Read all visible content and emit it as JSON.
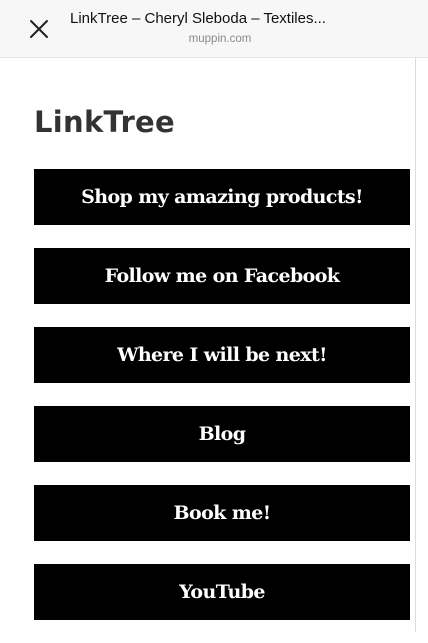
{
  "browser": {
    "title": "LinkTree – Cheryl Sleboda – Textiles...",
    "domain": "muppin.com"
  },
  "page": {
    "heading": "LinkTree"
  },
  "links": [
    "Shop my amazing products!",
    "Follow me on Facebook",
    "Where I will be next!",
    "Blog",
    "Book me!",
    "YouTube"
  ]
}
